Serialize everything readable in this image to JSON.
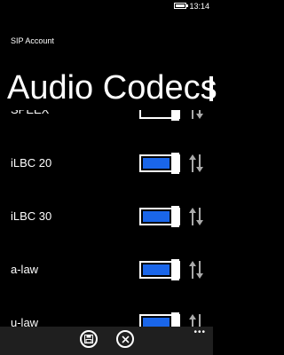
{
  "status": {
    "time": "13:14"
  },
  "app": {
    "title": "SIP Account"
  },
  "page": {
    "title": "Audio Codecs"
  },
  "codecs": [
    {
      "label": "SPEEX",
      "enabled": false
    },
    {
      "label": "iLBC 20",
      "enabled": true
    },
    {
      "label": "iLBC 30",
      "enabled": true
    },
    {
      "label": "a-law",
      "enabled": true
    },
    {
      "label": "u-law",
      "enabled": true
    }
  ],
  "app_bar": {
    "buttons": [
      {
        "icon": "save-icon"
      },
      {
        "icon": "close-icon"
      }
    ],
    "more_label": "•••"
  },
  "colors": {
    "accent": "#1a66ea",
    "background": "#000000",
    "app_bar": "#1f1f1f"
  }
}
